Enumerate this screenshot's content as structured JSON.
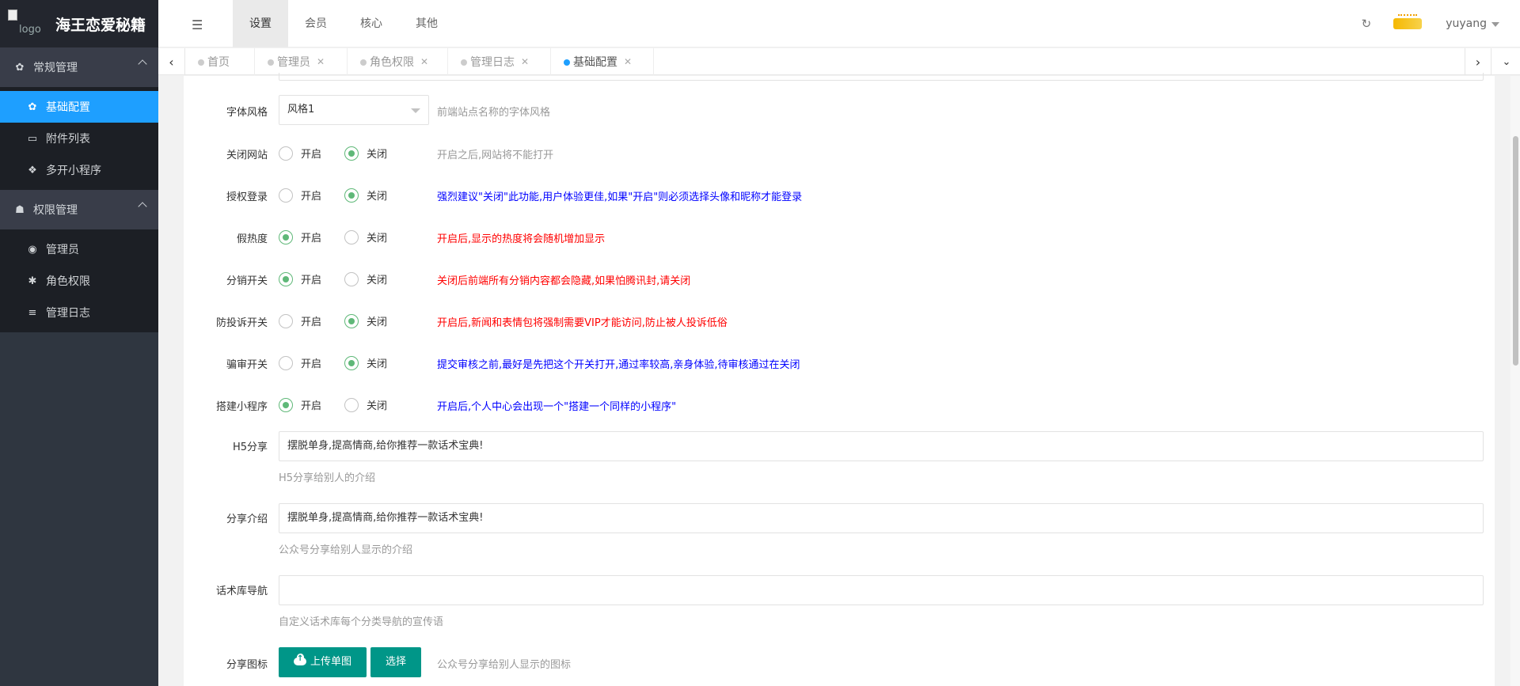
{
  "app": {
    "logo_alt": "logo",
    "title": "海王恋爱秘籍"
  },
  "sidebar": {
    "groups": [
      {
        "label": "常规管理",
        "icon": "gear-icon",
        "items": [
          {
            "label": "基础配置",
            "icon": "gear-icon",
            "active": true
          },
          {
            "label": "附件列表",
            "icon": "folder-open-icon",
            "active": false
          },
          {
            "label": "多开小程序",
            "icon": "cube-icon",
            "active": false
          }
        ]
      },
      {
        "label": "权限管理",
        "icon": "group-icon",
        "items": [
          {
            "label": "管理员",
            "icon": "user-circle-icon",
            "active": false
          },
          {
            "label": "角色权限",
            "icon": "bug-icon",
            "active": false
          },
          {
            "label": "管理日志",
            "icon": "list-icon",
            "active": false
          }
        ]
      }
    ]
  },
  "header": {
    "nav": [
      {
        "label": "设置",
        "active": true
      },
      {
        "label": "会员",
        "active": false
      },
      {
        "label": "核心",
        "active": false
      },
      {
        "label": "其他",
        "active": false
      }
    ],
    "username": "yuyang"
  },
  "tabs": [
    {
      "label": "首页",
      "closable": false,
      "active": false
    },
    {
      "label": "管理员",
      "closable": true,
      "active": false
    },
    {
      "label": "角色权限",
      "closable": true,
      "active": false
    },
    {
      "label": "管理日志",
      "closable": true,
      "active": false
    },
    {
      "label": "基础配置",
      "closable": true,
      "active": true
    }
  ],
  "form": {
    "font_style": {
      "label": "字体风格",
      "value": "风格1",
      "tip": "前端站点名称的字体风格"
    },
    "radio_on": "开启",
    "radio_off": "关闭",
    "toggles": [
      {
        "label": "关闭网站",
        "value": "off",
        "tip": "开启之后,网站将不能打开",
        "tip_color": "gray"
      },
      {
        "label": "授权登录",
        "value": "off",
        "tip": "强烈建议\"关闭\"此功能,用户体验更佳,如果\"开启\"则必须选择头像和昵称才能登录",
        "tip_color": "blue"
      },
      {
        "label": "假热度",
        "value": "on",
        "tip": "开启后,显示的热度将会随机增加显示",
        "tip_color": "red"
      },
      {
        "label": "分销开关",
        "value": "on",
        "tip": "关闭后前端所有分销内容都会隐藏,如果怕腾讯封,请关闭",
        "tip_color": "red"
      },
      {
        "label": "防投诉开关",
        "value": "off",
        "tip": "开启后,新闻和表情包将强制需要VIP才能访问,防止被人投诉低俗",
        "tip_color": "red"
      },
      {
        "label": "骗审开关",
        "value": "off",
        "tip": "提交审核之前,最好是先把这个开关打开,通过率较高,亲身体验,待审核通过在关闭",
        "tip_color": "blue"
      },
      {
        "label": "搭建小程序",
        "value": "on",
        "tip": "开启后,个人中心会出现一个\"搭建一个同样的小程序\"",
        "tip_color": "blue"
      }
    ],
    "h5_share": {
      "label": "H5分享",
      "value": "摆脱单身,提高情商,给你推荐一款话术宝典!",
      "help": "H5分享给别人的介绍"
    },
    "share_intro": {
      "label": "分享介绍",
      "value": "摆脱单身,提高情商,给你推荐一款话术宝典!",
      "help": "公众号分享给别人显示的介绍"
    },
    "library_nav": {
      "label": "话术库导航",
      "value": "",
      "help": "自定义话术库每个分类导航的宣传语"
    },
    "share_icon": {
      "label": "分享图标",
      "upload_label": "上传单图",
      "select_label": "选择",
      "tip": "公众号分享给别人显示的图标"
    }
  },
  "colors": {
    "sidebar_bg": "#2f3640",
    "active_blue": "#1e9fff",
    "radio_green": "#5fb878",
    "button_teal": "#009688",
    "tip_red": "#ff0000",
    "tip_blue": "#0000ff"
  }
}
